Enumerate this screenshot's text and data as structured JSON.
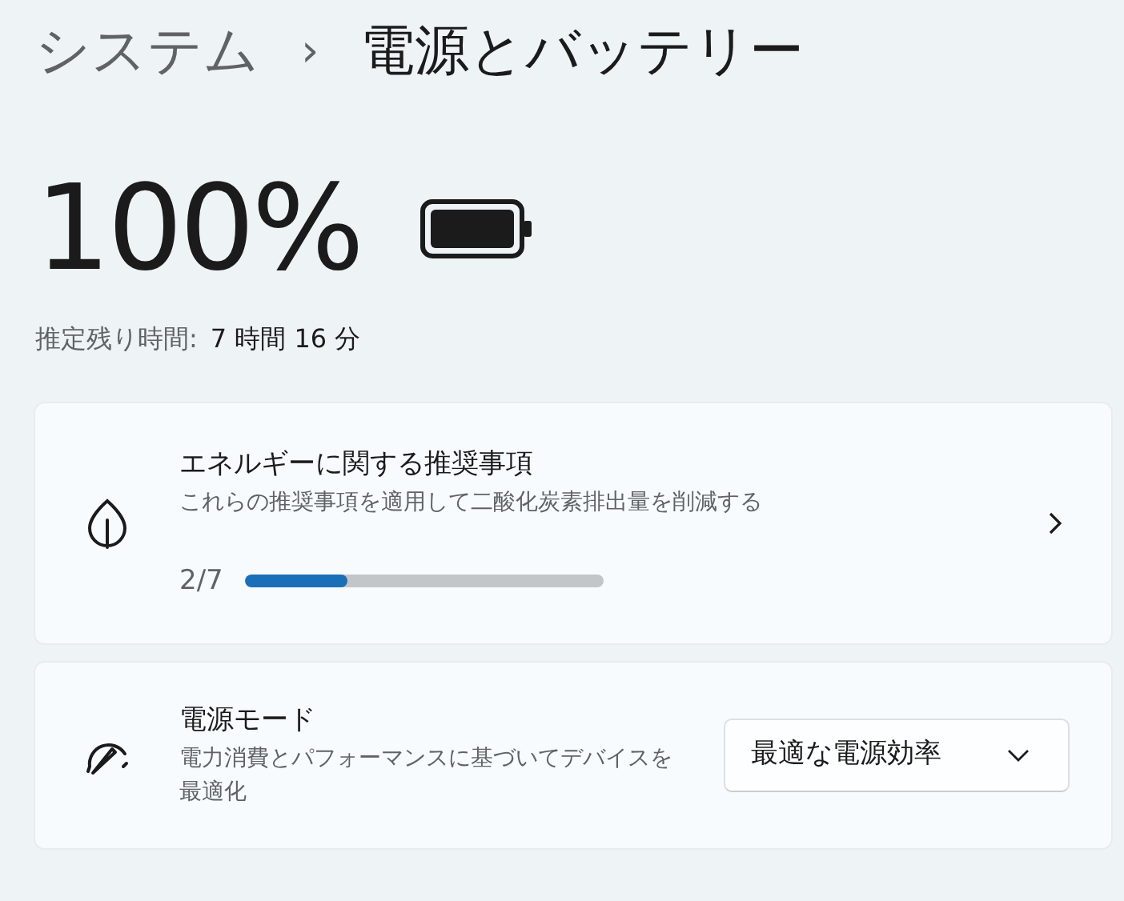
{
  "breadcrumb": {
    "parent": "システム",
    "separator": "›",
    "current": "電源とバッテリー"
  },
  "battery": {
    "percent": "100%",
    "estimate_label": "推定残り時間:",
    "estimate_value": "7 時間 16 分"
  },
  "cards": [
    {
      "kind": "progress",
      "title": "エネルギーに関する推奨事項",
      "description": "これらの推奨事項を適用して二酸化炭素排出量を削減する",
      "progress_text": "2/7",
      "level": 0.2857
    },
    {
      "kind": "dropdown",
      "title": "電源モード",
      "description": "電力消費とパフォーマンスに基づいてデバイスを最適化",
      "value": "最適な電源効率"
    }
  ]
}
